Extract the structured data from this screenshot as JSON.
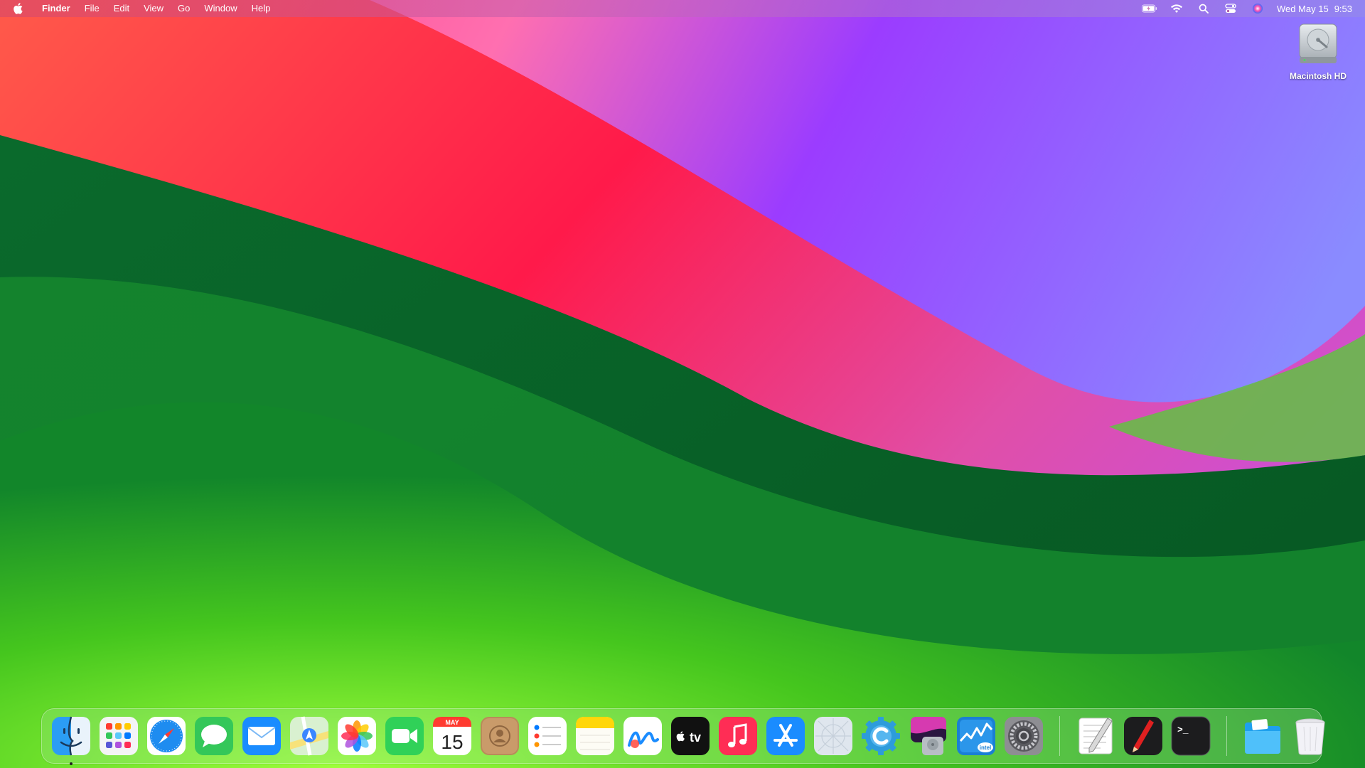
{
  "menubar": {
    "apple_icon": "apple-logo-icon",
    "app_name": "Finder",
    "menus": [
      "File",
      "Edit",
      "View",
      "Go",
      "Window",
      "Help"
    ],
    "status_icons": [
      "battery-charging-icon",
      "wifi-icon",
      "spotlight-search-icon",
      "control-center-icon",
      "siri-icon"
    ],
    "date": "Wed May 15",
    "time": "9:53"
  },
  "desktop": {
    "items": [
      {
        "label": "Macintosh HD",
        "icon": "hard-drive-icon"
      }
    ]
  },
  "dock": {
    "apps": [
      {
        "name": "Finder",
        "icon": "finder-icon",
        "running": true
      },
      {
        "name": "Launchpad",
        "icon": "launchpad-icon",
        "running": false
      },
      {
        "name": "Safari",
        "icon": "safari-icon",
        "running": false
      },
      {
        "name": "Messages",
        "icon": "messages-icon",
        "running": false
      },
      {
        "name": "Mail",
        "icon": "mail-icon",
        "running": false
      },
      {
        "name": "Maps",
        "icon": "maps-icon",
        "running": false
      },
      {
        "name": "Photos",
        "icon": "photos-icon",
        "running": false
      },
      {
        "name": "FaceTime",
        "icon": "facetime-icon",
        "running": false
      },
      {
        "name": "Calendar",
        "icon": "calendar-icon",
        "running": false,
        "month": "MAY",
        "day": "15"
      },
      {
        "name": "Contacts",
        "icon": "contacts-icon",
        "running": false
      },
      {
        "name": "Reminders",
        "icon": "reminders-icon",
        "running": false
      },
      {
        "name": "Notes",
        "icon": "notes-icon",
        "running": false
      },
      {
        "name": "Freeform",
        "icon": "freeform-icon",
        "running": false
      },
      {
        "name": "TV",
        "icon": "apple-tv-icon",
        "running": false,
        "text": "tv"
      },
      {
        "name": "Music",
        "icon": "music-icon",
        "running": false
      },
      {
        "name": "App Store",
        "icon": "app-store-icon",
        "running": false
      },
      {
        "name": "Placeholder App",
        "icon": "generic-app-icon",
        "running": false
      },
      {
        "name": "Utility",
        "icon": "c-gear-icon",
        "running": false
      },
      {
        "name": "Disk Utility",
        "icon": "disk-utility-icon",
        "running": false
      },
      {
        "name": "Intel Monitor",
        "icon": "intel-graph-icon",
        "running": false,
        "text": "intel"
      },
      {
        "name": "System Settings",
        "icon": "system-settings-icon",
        "running": false
      }
    ],
    "utilities": [
      {
        "name": "TextEdit",
        "icon": "textedit-icon"
      },
      {
        "name": "Script Editor",
        "icon": "script-editor-icon"
      },
      {
        "name": "Terminal",
        "icon": "terminal-icon",
        "text": ">_"
      }
    ],
    "stacks": [
      {
        "name": "Downloads",
        "icon": "folder-icon"
      },
      {
        "name": "Trash",
        "icon": "trash-icon"
      }
    ]
  }
}
